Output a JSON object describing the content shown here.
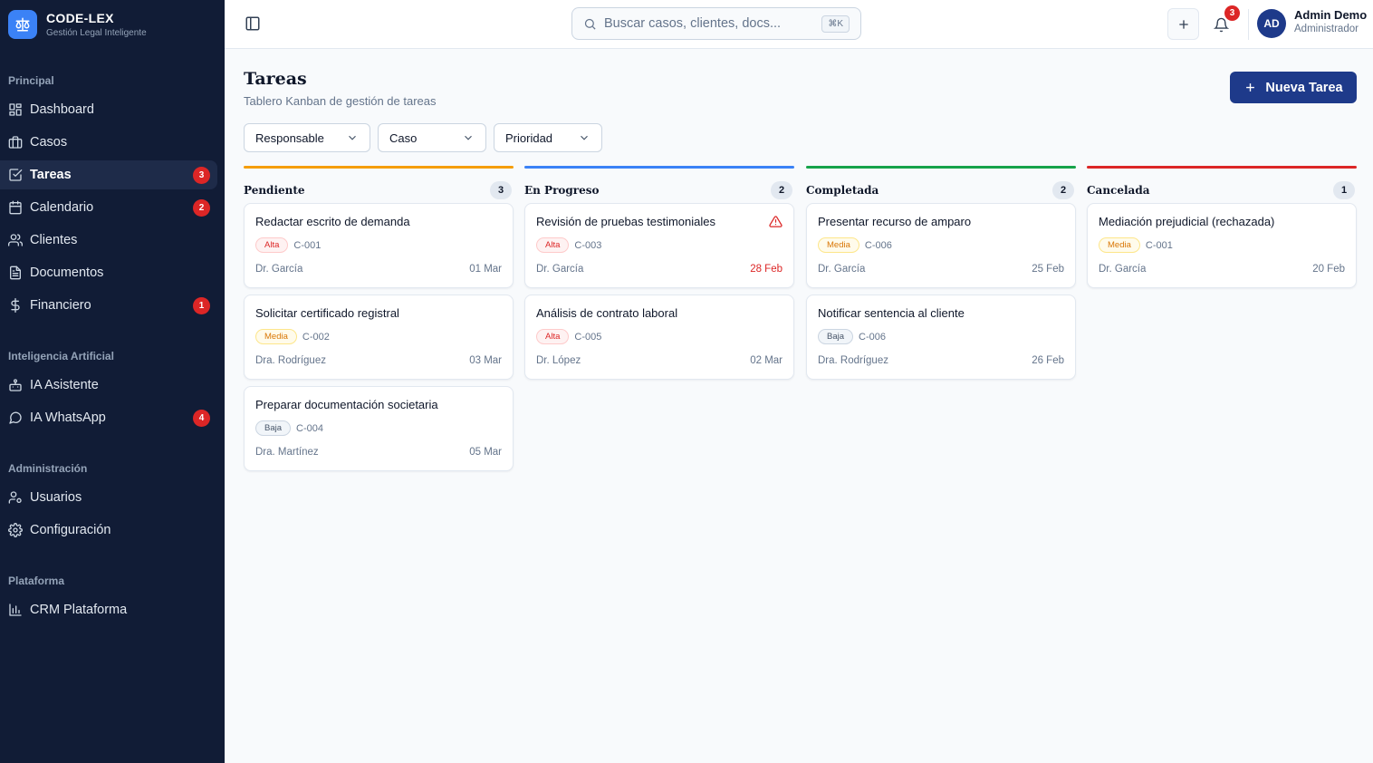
{
  "brand": {
    "title": "CODE-LEX",
    "subtitle": "Gestión Legal Inteligente"
  },
  "sidebar": {
    "sections": [
      "Principal",
      "Inteligencia Artificial",
      "Administración",
      "Plataforma"
    ],
    "items": [
      {
        "label": "Dashboard",
        "icon": "dashboard-icon",
        "badge": null
      },
      {
        "label": "Casos",
        "icon": "briefcase-icon",
        "badge": null
      },
      {
        "label": "Tareas",
        "icon": "checkbox-icon",
        "badge": "3",
        "active": true
      },
      {
        "label": "Calendario",
        "icon": "calendar-icon",
        "badge": "2"
      },
      {
        "label": "Clientes",
        "icon": "users-icon",
        "badge": null
      },
      {
        "label": "Documentos",
        "icon": "document-icon",
        "badge": null
      },
      {
        "label": "Financiero",
        "icon": "dollar-icon",
        "badge": "1"
      },
      {
        "label": "IA Asistente",
        "icon": "bot-icon",
        "badge": null
      },
      {
        "label": "IA WhatsApp",
        "icon": "chat-icon",
        "badge": "4"
      },
      {
        "label": "Usuarios",
        "icon": "user-cog-icon",
        "badge": null
      },
      {
        "label": "Configuración",
        "icon": "gear-icon",
        "badge": null
      },
      {
        "label": "CRM Plataforma",
        "icon": "bar-chart-icon",
        "badge": null
      }
    ]
  },
  "topbar": {
    "search_placeholder": "Buscar casos, clientes, docs...",
    "search_shortcut": "⌘K",
    "notifications_count": "3",
    "user": {
      "initials": "AD",
      "name": "Admin Demo",
      "role": "Administrador"
    }
  },
  "page": {
    "title": "Tareas",
    "subtitle": "Tablero Kanban de gestión de tareas",
    "new_button": "Nueva Tarea",
    "filters": [
      "Responsable",
      "Caso",
      "Prioridad"
    ]
  },
  "colors": {
    "pendiente": "#f59e0b",
    "en_progreso": "#3b82f6",
    "completada": "#16a34a",
    "cancelada": "#dc2626",
    "primary": "#1e3a8a"
  },
  "columns": [
    {
      "title": "Pendiente",
      "count": "3",
      "cards": [
        {
          "title": "Redactar escrito de demanda",
          "priority": "Alta",
          "case": "C-001",
          "assignee": "Dr. García",
          "due": "01 Mar"
        },
        {
          "title": "Solicitar certificado registral",
          "priority": "Media",
          "case": "C-002",
          "assignee": "Dra. Rodríguez",
          "due": "03 Mar"
        },
        {
          "title": "Preparar documentación societaria",
          "priority": "Baja",
          "case": "C-004",
          "assignee": "Dra. Martínez",
          "due": "05 Mar"
        }
      ]
    },
    {
      "title": "En Progreso",
      "count": "2",
      "cards": [
        {
          "title": "Revisión de pruebas testimoniales",
          "priority": "Alta",
          "case": "C-003",
          "assignee": "Dr. García",
          "due": "28 Feb",
          "overdue": true
        },
        {
          "title": "Análisis de contrato laboral",
          "priority": "Alta",
          "case": "C-005",
          "assignee": "Dr. López",
          "due": "02 Mar"
        }
      ]
    },
    {
      "title": "Completada",
      "count": "2",
      "cards": [
        {
          "title": "Presentar recurso de amparo",
          "priority": "Media",
          "case": "C-006",
          "assignee": "Dr. García",
          "due": "25 Feb"
        },
        {
          "title": "Notificar sentencia al cliente",
          "priority": "Baja",
          "case": "C-006",
          "assignee": "Dra. Rodríguez",
          "due": "26 Feb"
        }
      ]
    },
    {
      "title": "Cancelada",
      "count": "1",
      "cards": [
        {
          "title": "Mediación prejudicial (rechazada)",
          "priority": "Media",
          "case": "C-001",
          "assignee": "Dr. García",
          "due": "20 Feb"
        }
      ]
    }
  ]
}
